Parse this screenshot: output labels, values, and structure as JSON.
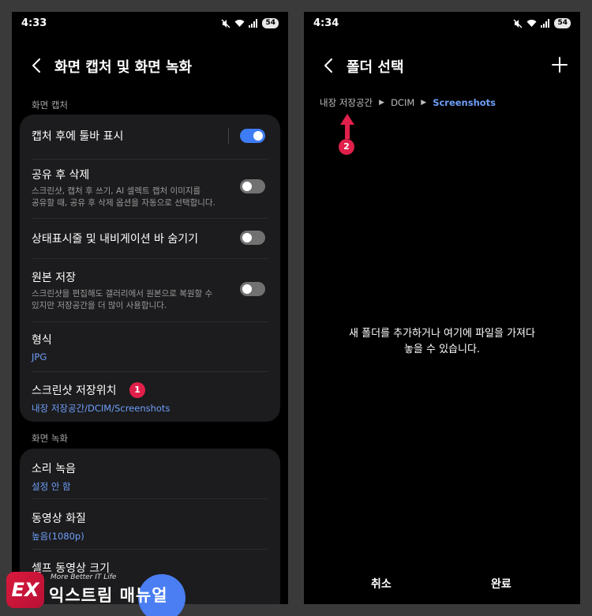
{
  "left_screen": {
    "status": {
      "time": "4:33",
      "battery": "54"
    },
    "header": {
      "title": "화면 캡처 및 화면 녹화"
    },
    "sections": {
      "capture": "화면 캡처",
      "recording": "화면 녹화"
    },
    "capture_items": [
      {
        "title": "캡처 후에 툴바 표시",
        "toggle": "on"
      },
      {
        "title": "공유 후 삭제",
        "desc_line1": "스크린샷, 캡처 후 쓰기, AI 셀렉트 캡처 이미지를",
        "desc_line2": "공유할 때, 공유 후 삭제 옵션을 자동으로 선택합니다.",
        "toggle": "off"
      },
      {
        "title": "상태표시줄 및 내비게이션 바 숨기기",
        "toggle": "off"
      },
      {
        "title": "원본 저장",
        "desc_line1": "스크린샷을 편집해도 갤러리에서 원본으로 복원할 수",
        "desc_line2": "있지만 저장공간을 더 많이 사용합니다.",
        "toggle": "off"
      },
      {
        "title": "형식",
        "value": "JPG"
      },
      {
        "title": "스크린샷 저장위치",
        "value": "내장 저장공간/DCIM/Screenshots",
        "badge": "1"
      }
    ],
    "recording_items": [
      {
        "title": "소리 녹음",
        "value": "설정 안 함"
      },
      {
        "title": "동영상 화질",
        "value": "높음(1080p)"
      },
      {
        "title": "셀프 동영상 크기"
      }
    ]
  },
  "right_screen": {
    "status": {
      "time": "4:34",
      "battery": "54"
    },
    "header": {
      "title": "폴더 선택"
    },
    "breadcrumb": [
      "내장 저장공간",
      "DCIM",
      "Screenshots"
    ],
    "badge": "2",
    "empty_message_line1": "새 폴더를 추가하거나 여기에 파일을 가져다",
    "empty_message_line2": "놓을 수 있습니다.",
    "cancel_label": "취소",
    "done_label": "완료"
  },
  "watermark": {
    "logo_text": "EX",
    "tagline": "More Better IT Life",
    "name": "익스트림 매뉴얼"
  },
  "colors": {
    "accent": "#3e7cf6",
    "link": "#6e9ef8",
    "badge": "#e0204a",
    "card": "#1c1c1e"
  },
  "icons": [
    "back-icon",
    "add-icon",
    "mute-icon",
    "wifi-icon",
    "signal-icon",
    "up-arrow-icon"
  ]
}
